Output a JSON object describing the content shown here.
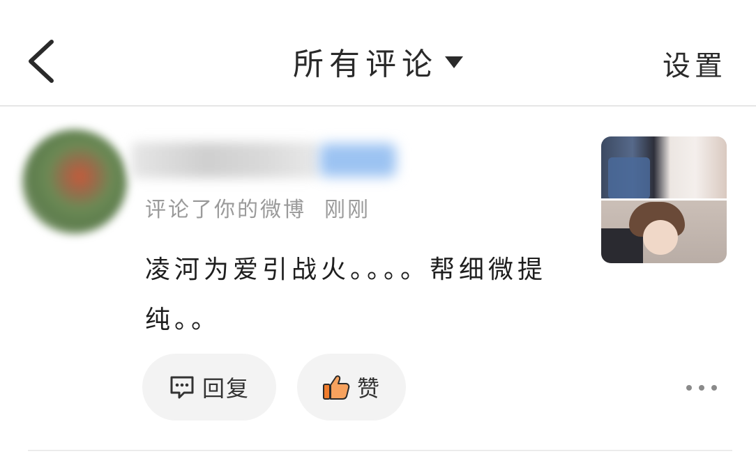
{
  "header": {
    "title": "所有评论",
    "settings_label": "设置"
  },
  "comment": {
    "meta_text": "评论了你的微博",
    "time": "刚刚",
    "content": "凌河为爱引战火。。。。帮细微提纯。。",
    "actions": {
      "reply_label": "回复",
      "like_label": "赞"
    }
  },
  "icons": {
    "back": "chevron-left-icon",
    "dropdown": "caret-down-icon",
    "reply": "comment-bubble-icon",
    "like": "thumbs-up-icon",
    "more": "more-horizontal-icon"
  },
  "colors": {
    "like_accent": "#f07c2c",
    "meta_gray": "#9a9a9a",
    "pill_bg": "#f3f3f3"
  }
}
